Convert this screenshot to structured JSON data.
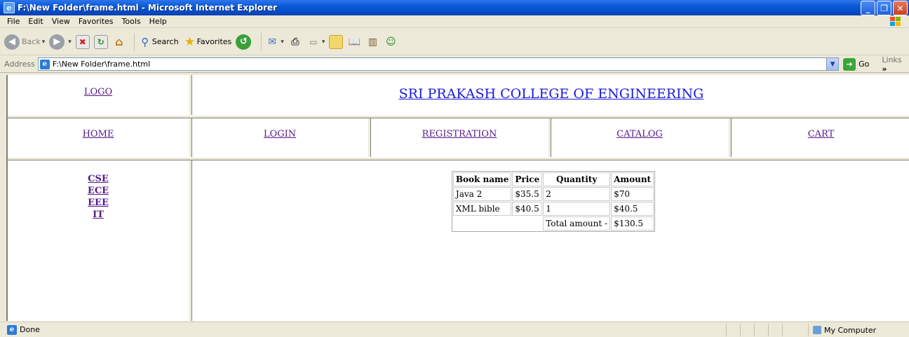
{
  "window": {
    "title": "F:\\New Folder\\frame.html - Microsoft Internet Explorer"
  },
  "menu": [
    "File",
    "Edit",
    "View",
    "Favorites",
    "Tools",
    "Help"
  ],
  "toolbar": {
    "back": "Back",
    "search": "Search",
    "favorites": "Favorites"
  },
  "address": {
    "label": "Address",
    "url": "F:\\New Folder\\frame.html",
    "go": "Go",
    "links": "Links"
  },
  "frames": {
    "logo": "LOGO",
    "college": "SRI PRAKASH COLLEGE OF ENGINEERING",
    "nav": [
      "HOME",
      "LOGIN",
      "REGISTRATION",
      "CATALOG",
      "CART"
    ],
    "depts": [
      "CSE",
      "ECE",
      "EEE",
      "IT"
    ]
  },
  "cart": {
    "headers": [
      "Book name",
      "Price",
      "Quantity",
      "Amount"
    ],
    "rows": [
      [
        "Java 2",
        "$35.5",
        "2",
        "$70"
      ],
      [
        "XML bible",
        "$40.5",
        "1",
        "$40.5"
      ]
    ],
    "total_label": "Total amount -",
    "total_value": "$130.5"
  },
  "status": {
    "text": "Done",
    "zone": "My Computer"
  }
}
